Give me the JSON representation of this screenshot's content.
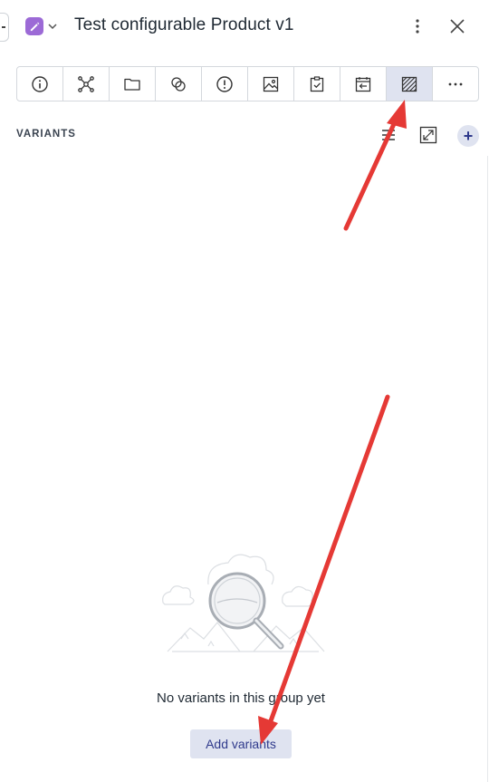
{
  "header": {
    "title": "Test configurable Product v1",
    "type_icon": "pencil-icon",
    "more_icon": "kebab-icon",
    "close_icon": "close-icon"
  },
  "toolbar": {
    "buttons": [
      {
        "name": "info-icon"
      },
      {
        "name": "network-icon"
      },
      {
        "name": "folder-icon"
      },
      {
        "name": "circles-icon"
      },
      {
        "name": "alert-icon"
      },
      {
        "name": "image-icon"
      },
      {
        "name": "clipboard-check-icon"
      },
      {
        "name": "calendar-arrow-icon"
      },
      {
        "name": "variants-hatched-icon",
        "active": true
      },
      {
        "name": "more-horizontal-icon"
      }
    ]
  },
  "variants": {
    "section_label": "VARIANTS",
    "empty_message": "No variants in this group yet",
    "add_button_label": "Add variants"
  },
  "colors": {
    "accent": "#2f3a8c",
    "accent_bg": "#dfe3f0",
    "type_icon": "#9c6ad6",
    "annotation_arrow": "#e53935"
  }
}
